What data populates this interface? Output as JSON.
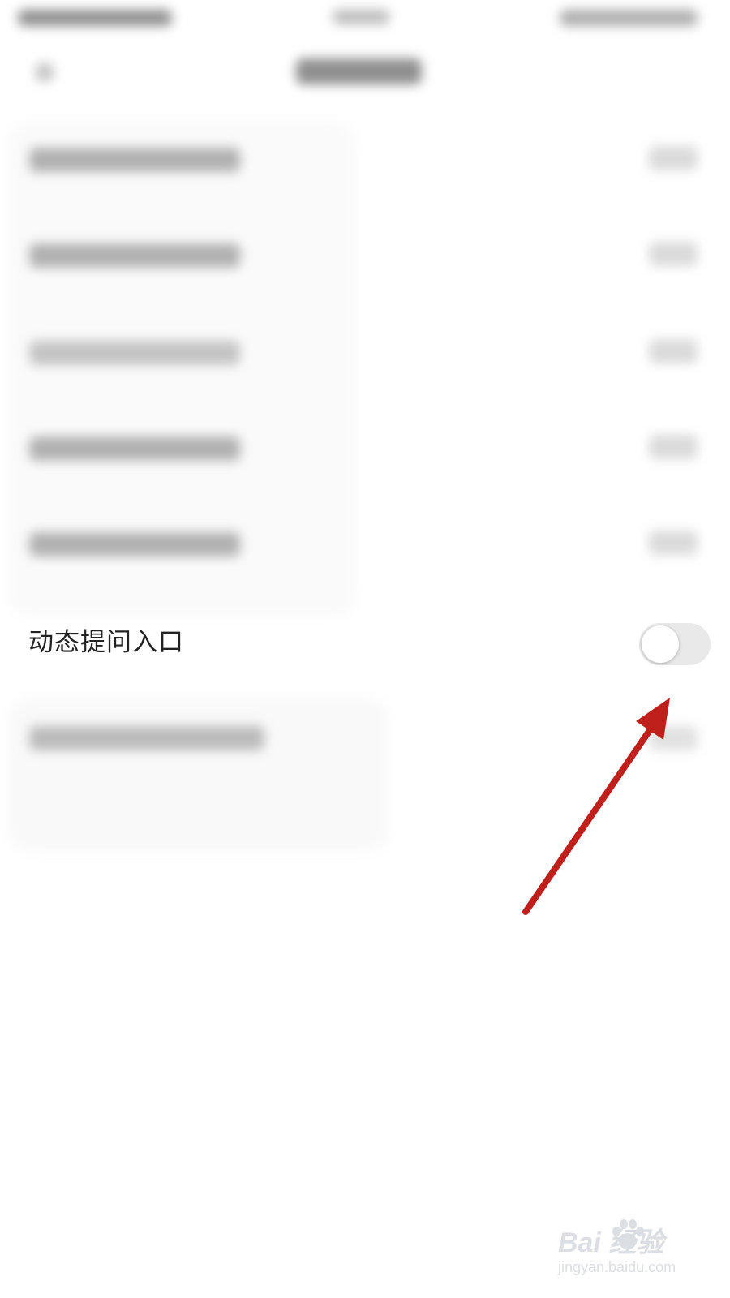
{
  "settings_row": {
    "label": "动态提问入口",
    "toggle_on": false,
    "toggle_track_color": "#e9e9ea",
    "toggle_knob_color": "#ffffff"
  },
  "annotation": {
    "color": "#c0201c",
    "shape": "arrow"
  },
  "watermark": {
    "logo_text": "Bai  经验",
    "sub_text": "jingyan.baidu.com"
  }
}
